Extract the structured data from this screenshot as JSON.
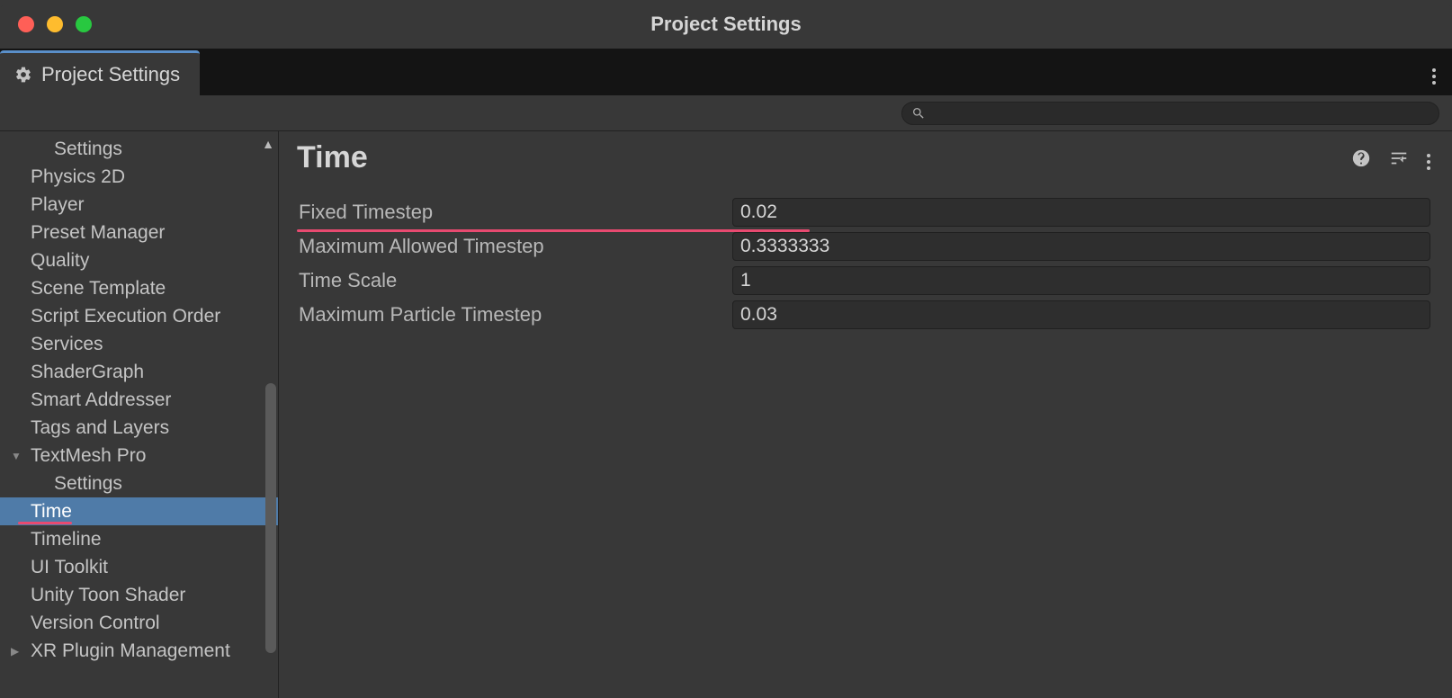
{
  "window": {
    "title": "Project Settings"
  },
  "tab": {
    "label": "Project Settings"
  },
  "search": {
    "placeholder": ""
  },
  "sidebar": {
    "items": [
      {
        "label": "Settings",
        "child": true,
        "selected": false,
        "expandable": false
      },
      {
        "label": "Physics 2D",
        "child": false,
        "selected": false,
        "expandable": false
      },
      {
        "label": "Player",
        "child": false,
        "selected": false,
        "expandable": false
      },
      {
        "label": "Preset Manager",
        "child": false,
        "selected": false,
        "expandable": false
      },
      {
        "label": "Quality",
        "child": false,
        "selected": false,
        "expandable": false
      },
      {
        "label": "Scene Template",
        "child": false,
        "selected": false,
        "expandable": false
      },
      {
        "label": "Script Execution Order",
        "child": false,
        "selected": false,
        "expandable": false
      },
      {
        "label": "Services",
        "child": false,
        "selected": false,
        "expandable": false
      },
      {
        "label": "ShaderGraph",
        "child": false,
        "selected": false,
        "expandable": false
      },
      {
        "label": "Smart Addresser",
        "child": false,
        "selected": false,
        "expandable": false
      },
      {
        "label": "Tags and Layers",
        "child": false,
        "selected": false,
        "expandable": false
      },
      {
        "label": "TextMesh Pro",
        "child": false,
        "selected": false,
        "expandable": true,
        "expanded": true
      },
      {
        "label": "Settings",
        "child": true,
        "selected": false,
        "expandable": false
      },
      {
        "label": "Time",
        "child": false,
        "selected": true,
        "expandable": false,
        "underline": true
      },
      {
        "label": "Timeline",
        "child": false,
        "selected": false,
        "expandable": false
      },
      {
        "label": "UI Toolkit",
        "child": false,
        "selected": false,
        "expandable": false
      },
      {
        "label": "Unity Toon Shader",
        "child": false,
        "selected": false,
        "expandable": false
      },
      {
        "label": "Version Control",
        "child": false,
        "selected": false,
        "expandable": false
      },
      {
        "label": "XR Plugin Management",
        "child": false,
        "selected": false,
        "expandable": true,
        "expanded": false
      }
    ]
  },
  "main": {
    "title": "Time",
    "properties": [
      {
        "label": "Fixed Timestep",
        "value": "0.02",
        "underline": true
      },
      {
        "label": "Maximum Allowed Timestep",
        "value": "0.3333333",
        "underline": false
      },
      {
        "label": "Time Scale",
        "value": "1",
        "underline": false
      },
      {
        "label": "Maximum Particle Timestep",
        "value": "0.03",
        "underline": false
      }
    ]
  },
  "annotation": {
    "color": "#e84a70"
  }
}
